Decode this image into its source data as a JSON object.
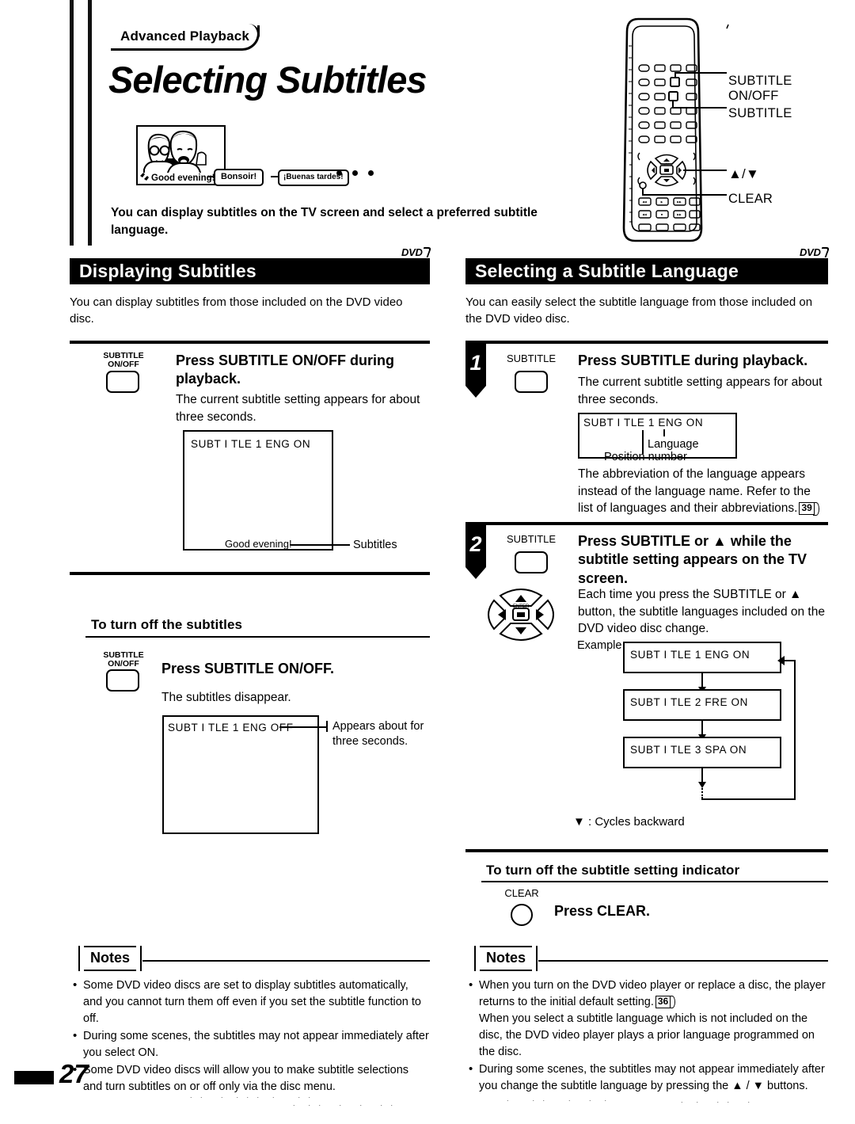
{
  "header": {
    "chapter_tag": "Advanced Playback",
    "title": "Selecting Subtitles",
    "intro": "You can display subtitles on the TV screen and select a preferred subtitle language."
  },
  "illustration": {
    "caption_english": "Good evening!",
    "bubble_french": "Bonsoir!",
    "bubble_spanish": "¡Buenas tardes!"
  },
  "remote": {
    "callouts": [
      "SUBTITLE\nON/OFF",
      "SUBTITLE",
      "▲/▼",
      "CLEAR"
    ],
    "callout_subtitle_onoff_line1": "SUBTITLE",
    "callout_subtitle_onoff_line2": "ON/OFF",
    "callout_subtitle": "SUBTITLE",
    "callout_updown": "▲/▼",
    "callout_clear": "CLEAR"
  },
  "left_column": {
    "band_title": "Displaying Subtitles",
    "dvd_badge": "DVD",
    "lede": "You can display subtitles from those included on the DVD video disc.",
    "step": {
      "button_label_line1": "SUBTITLE",
      "button_label_line2": "ON/OFF",
      "heading": "Press SUBTITLE ON/OFF during playback.",
      "body": "The current subtitle setting appears for about three seconds.",
      "osd_top": "SUBT I TLE  1  ENG  ON",
      "osd_subtitle_text": "Good evening!",
      "osd_leader_label": "Subtitles"
    },
    "turn_off": {
      "subhead": "To turn off the subtitles",
      "button_label_line1": "SUBTITLE",
      "button_label_line2": "ON/OFF",
      "heading": "Press SUBTITLE ON/OFF.",
      "body": "The subtitles disappear.",
      "osd_top": "SUBT I TLE  1  ENG  OFF",
      "leader_label": "Appears about for three seconds."
    },
    "notes_label": "Notes",
    "notes": [
      "Some DVD video discs are set to display subtitles automatically, and you cannot turn them off even if you set the subtitle function to off.",
      "During some scenes, the subtitles may not appear immediately after you select ON.",
      "Some DVD video discs will allow you to make subtitle selections and turn subtitles on or off only via the disc menu."
    ]
  },
  "right_column": {
    "band_title": "Selecting a Subtitle Language",
    "dvd_badge": "DVD",
    "lede": "You can easily select the subtitle language from those included on the DVD video disc.",
    "step1": {
      "number": "1",
      "button_label": "SUBTITLE",
      "heading": "Press SUBTITLE during playback.",
      "body": "The current subtitle setting appears for about three seconds.",
      "osd_top": "SUBT I TLE  1  ENG  ON",
      "annot_language": "Language",
      "annot_position": "Position number",
      "note": "The abbreviation of the language appears instead of the language name. Refer to the list of languages and their abbreviations.",
      "note_pageref": "39"
    },
    "step2": {
      "number": "2",
      "button_label": "SUBTITLE",
      "heading": "Press SUBTITLE or ▲ while the subtitle setting appears on the TV screen.",
      "body": "Each time you press the SUBTITLE or ▲ button, the subtitle languages included on the DVD video disc change.",
      "example_label": "Example",
      "cycle": [
        "SUBT I TLE  1  ENG  ON",
        "SUBT I TLE  2  FRE  ON",
        "SUBT I TLE  3  SPA  ON"
      ],
      "cycle_note": "▼ : Cycles backward"
    },
    "turn_off": {
      "subhead": "To turn off the subtitle setting indicator",
      "button_label": "CLEAR",
      "heading": "Press CLEAR."
    },
    "notes_label": "Notes",
    "notes": [
      {
        "text_a": "When you turn on the DVD video player or replace a disc, the player returns to the initial default setting.",
        "pageref": "36",
        "text_b": "When you select a subtitle language which is not included on the disc, the DVD video player plays a prior language programmed on the disc."
      },
      {
        "text_a": "During some scenes, the subtitles may not appear immediately after you change the subtitle language by pressing the ▲ / ▼ buttons.",
        "pageref": "",
        "text_b": ""
      }
    ]
  },
  "footer": {
    "page_number": "27"
  }
}
